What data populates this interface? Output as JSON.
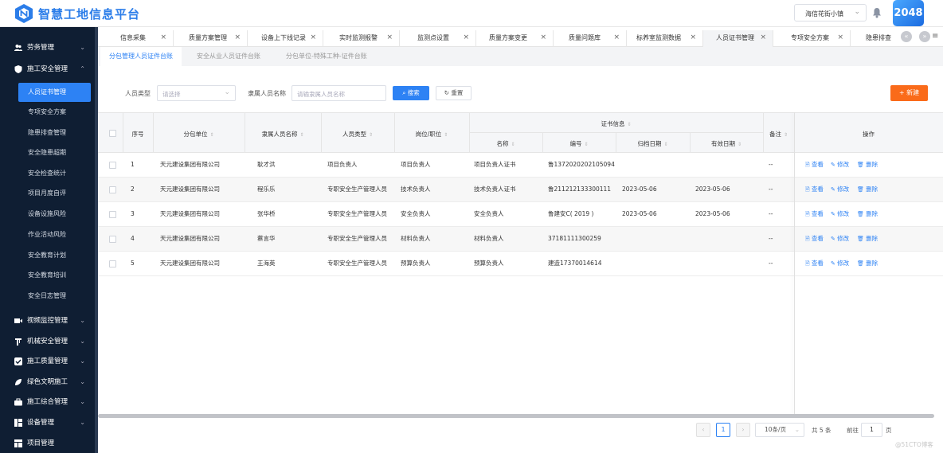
{
  "app": {
    "title": "智慧工地信息平台",
    "site": "海信花街小镇",
    "avatar_text": "2048",
    "accent": "#2d82f4"
  },
  "sidebar": {
    "groups": [
      {
        "label": "劳务管理",
        "icon": "users-icon"
      },
      {
        "label": "施工安全管理",
        "icon": "shield-icon"
      },
      {
        "label": "视频监控管理",
        "icon": "video-icon"
      },
      {
        "label": "机械安全管理",
        "icon": "crane-icon"
      },
      {
        "label": "施工质量管理",
        "icon": "check-icon"
      },
      {
        "label": "绿色文明施工",
        "icon": "leaf-icon"
      },
      {
        "label": "施工综合管理",
        "icon": "briefcase-icon"
      },
      {
        "label": "设备管理",
        "icon": "device-icon"
      },
      {
        "label": "项目管理",
        "icon": "grid-icon"
      }
    ],
    "items": [
      "人员证书管理",
      "专项安全方案",
      "隐患排查管理",
      "安全隐患超期",
      "安全检查统计",
      "项目月度自评",
      "设备设施风险",
      "作业活动风险",
      "安全教育计划",
      "安全教育培训",
      "安全日志管理"
    ]
  },
  "tabs": [
    "信息采集",
    "质量方案管理",
    "设备上下线记录",
    "实时监测报警",
    "监测点设置",
    "质量方案变更",
    "质量问题库",
    "标养室监测数据",
    "人员证书管理",
    "专项安全方案",
    "隐患排查",
    "×"
  ],
  "subtabs": [
    "分包管理人员证件台账",
    "安全从业人员证件台账",
    "分包单位-特殊工种-证件台账"
  ],
  "filters": {
    "type_label": "人员类型",
    "type_placeholder": "请选择",
    "name_label": "隶属人员名称",
    "name_placeholder": "请输隶属人员名称",
    "search": "搜索",
    "reset": "重置",
    "add": "新建"
  },
  "table": {
    "headers": {
      "index": "序号",
      "unit": "分包单位",
      "person": "隶属人员名称",
      "type": "人员类型",
      "post": "岗位/职位",
      "cert_group": "证书信息",
      "cert_name": "名称",
      "cert_no": "编号",
      "file_date": "归档日期",
      "expire": "有效日期",
      "remark": "备注",
      "ops": "操作"
    },
    "rows": [
      {
        "index": "1",
        "unit": "天元建设集团有限公司",
        "person": "耿才洪",
        "type": "项目负责人",
        "post": "项目负责人",
        "cert_name": "项目负责人证书",
        "cert_no": "鲁1372020202105094",
        "file_date": "",
        "expire": "",
        "remark": "--"
      },
      {
        "index": "2",
        "unit": "天元建设集团有限公司",
        "person": "程乐乐",
        "type": "专职安全生产管理人员",
        "post": "技术负责人",
        "cert_name": "技术负责人证书",
        "cert_no": "鲁211212133300111",
        "file_date": "2023-05-06",
        "expire": "2023-05-06",
        "remark": "--"
      },
      {
        "index": "3",
        "unit": "天元建设集团有限公司",
        "person": "张华桥",
        "type": "专职安全生产管理人员",
        "post": "安全负责人",
        "cert_name": "安全负责人",
        "cert_no": "鲁建安C( 2019 )",
        "file_date": "2023-05-06",
        "expire": "2023-05-06",
        "remark": "--"
      },
      {
        "index": "4",
        "unit": "天元建设集团有限公司",
        "person": "蔡言华",
        "type": "专职安全生产管理人员",
        "post": "材料负责人",
        "cert_name": "材料负责人",
        "cert_no": "37181111300259",
        "file_date": "",
        "expire": "",
        "remark": "--"
      },
      {
        "index": "5",
        "unit": "天元建设集团有限公司",
        "person": "王海英",
        "type": "专职安全生产管理人员",
        "post": "预算负责人",
        "cert_name": "预算负责人",
        "cert_no": "建造17370014614",
        "file_date": "",
        "expire": "",
        "remark": "--"
      }
    ],
    "actions": {
      "view": "查看",
      "edit": "修改",
      "delete": "删除"
    }
  },
  "pagination": {
    "current": "1",
    "size": "10条/页",
    "total": "共 5 条",
    "goto": "前往",
    "goto_value": "1",
    "page_unit": "页"
  },
  "watermark": "@51CTO博客"
}
